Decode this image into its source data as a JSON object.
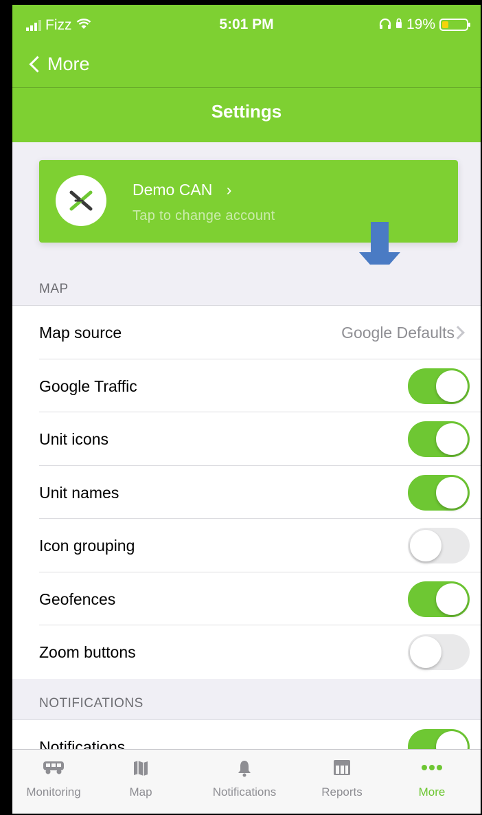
{
  "status_bar": {
    "carrier": "Fizz",
    "time": "5:01 PM",
    "battery": "19%"
  },
  "nav": {
    "back_label": "More",
    "title": "Settings"
  },
  "account": {
    "name": "Demo CAN",
    "name_chevron": "›",
    "subtitle": "Tap to change account"
  },
  "sections": {
    "map": {
      "header": "MAP",
      "rows": [
        {
          "label": "Map source",
          "value": "Google Defaults"
        },
        {
          "label": "Google Traffic",
          "enabled": true
        },
        {
          "label": "Unit icons",
          "enabled": true
        },
        {
          "label": "Unit names",
          "enabled": true
        },
        {
          "label": "Icon grouping",
          "enabled": false
        },
        {
          "label": "Geofences",
          "enabled": true
        },
        {
          "label": "Zoom buttons",
          "enabled": false
        }
      ]
    },
    "notifications": {
      "header": "NOTIFICATIONS",
      "rows": [
        {
          "label": "Notifications",
          "enabled": true
        }
      ]
    }
  },
  "tabbar": {
    "items": [
      {
        "label": "Monitoring",
        "icon": "van-icon"
      },
      {
        "label": "Map",
        "icon": "map-icon"
      },
      {
        "label": "Notifications",
        "icon": "bell-icon"
      },
      {
        "label": "Reports",
        "icon": "table-icon"
      },
      {
        "label": "More",
        "icon": "ellipsis-icon",
        "active": true
      }
    ]
  },
  "colors": {
    "accent": "#7ed032",
    "switch_on": "#6ec733",
    "annotation_arrow": "#4a7bc4"
  }
}
